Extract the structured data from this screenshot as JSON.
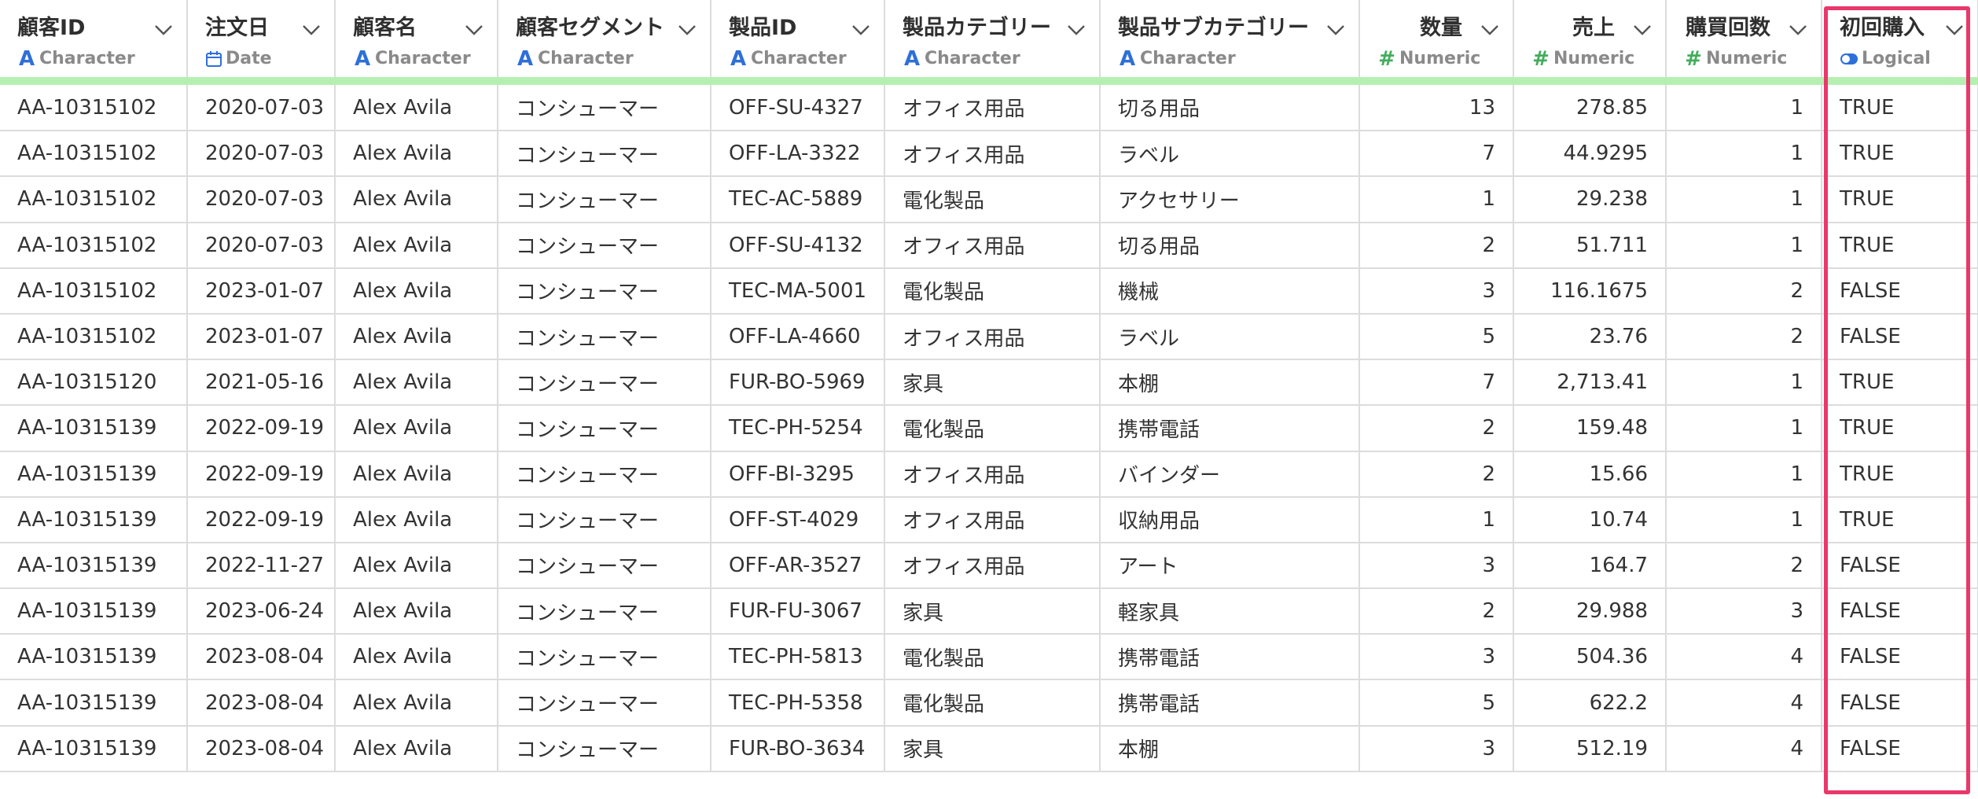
{
  "columns": [
    {
      "name": "顧客ID",
      "type": "Character",
      "type_icon": "character-icon",
      "align": "left"
    },
    {
      "name": "注文日",
      "type": "Date",
      "type_icon": "calendar-icon",
      "align": "left"
    },
    {
      "name": "顧客名",
      "type": "Character",
      "type_icon": "character-icon",
      "align": "left"
    },
    {
      "name": "顧客セグメント",
      "type": "Character",
      "type_icon": "character-icon",
      "align": "left"
    },
    {
      "name": "製品ID",
      "type": "Character",
      "type_icon": "character-icon",
      "align": "left"
    },
    {
      "name": "製品カテゴリー",
      "type": "Character",
      "type_icon": "character-icon",
      "align": "left"
    },
    {
      "name": "製品サブカテゴリー",
      "type": "Character",
      "type_icon": "character-icon",
      "align": "left"
    },
    {
      "name": "数量",
      "type": "Numeric",
      "type_icon": "numeric-icon",
      "align": "right"
    },
    {
      "name": "売上",
      "type": "Numeric",
      "type_icon": "numeric-icon",
      "align": "right"
    },
    {
      "name": "購買回数",
      "type": "Numeric",
      "type_icon": "numeric-icon",
      "align": "right"
    },
    {
      "name": "初回購入",
      "type": "Logical",
      "type_icon": "toggle-icon",
      "align": "left"
    }
  ],
  "rows": [
    [
      "AA-10315102",
      "2020-07-03",
      "Alex Avila",
      "コンシューマー",
      "OFF-SU-4327",
      "オフィス用品",
      "切る用品",
      "13",
      "278.85",
      "1",
      "TRUE"
    ],
    [
      "AA-10315102",
      "2020-07-03",
      "Alex Avila",
      "コンシューマー",
      "OFF-LA-3322",
      "オフィス用品",
      "ラベル",
      "7",
      "44.9295",
      "1",
      "TRUE"
    ],
    [
      "AA-10315102",
      "2020-07-03",
      "Alex Avila",
      "コンシューマー",
      "TEC-AC-5889",
      "電化製品",
      "アクセサリー",
      "1",
      "29.238",
      "1",
      "TRUE"
    ],
    [
      "AA-10315102",
      "2020-07-03",
      "Alex Avila",
      "コンシューマー",
      "OFF-SU-4132",
      "オフィス用品",
      "切る用品",
      "2",
      "51.711",
      "1",
      "TRUE"
    ],
    [
      "AA-10315102",
      "2023-01-07",
      "Alex Avila",
      "コンシューマー",
      "TEC-MA-5001",
      "電化製品",
      "機械",
      "3",
      "116.1675",
      "2",
      "FALSE"
    ],
    [
      "AA-10315102",
      "2023-01-07",
      "Alex Avila",
      "コンシューマー",
      "OFF-LA-4660",
      "オフィス用品",
      "ラベル",
      "5",
      "23.76",
      "2",
      "FALSE"
    ],
    [
      "AA-10315120",
      "2021-05-16",
      "Alex Avila",
      "コンシューマー",
      "FUR-BO-5969",
      "家具",
      "本棚",
      "7",
      "2,713.41",
      "1",
      "TRUE"
    ],
    [
      "AA-10315139",
      "2022-09-19",
      "Alex Avila",
      "コンシューマー",
      "TEC-PH-5254",
      "電化製品",
      "携帯電話",
      "2",
      "159.48",
      "1",
      "TRUE"
    ],
    [
      "AA-10315139",
      "2022-09-19",
      "Alex Avila",
      "コンシューマー",
      "OFF-BI-3295",
      "オフィス用品",
      "バインダー",
      "2",
      "15.66",
      "1",
      "TRUE"
    ],
    [
      "AA-10315139",
      "2022-09-19",
      "Alex Avila",
      "コンシューマー",
      "OFF-ST-4029",
      "オフィス用品",
      "収納用品",
      "1",
      "10.74",
      "1",
      "TRUE"
    ],
    [
      "AA-10315139",
      "2022-11-27",
      "Alex Avila",
      "コンシューマー",
      "OFF-AR-3527",
      "オフィス用品",
      "アート",
      "3",
      "164.7",
      "2",
      "FALSE"
    ],
    [
      "AA-10315139",
      "2023-06-24",
      "Alex Avila",
      "コンシューマー",
      "FUR-FU-3067",
      "家具",
      "軽家具",
      "2",
      "29.988",
      "3",
      "FALSE"
    ],
    [
      "AA-10315139",
      "2023-08-04",
      "Alex Avila",
      "コンシューマー",
      "TEC-PH-5813",
      "電化製品",
      "携帯電話",
      "3",
      "504.36",
      "4",
      "FALSE"
    ],
    [
      "AA-10315139",
      "2023-08-04",
      "Alex Avila",
      "コンシューマー",
      "TEC-PH-5358",
      "電化製品",
      "携帯電話",
      "5",
      "622.2",
      "4",
      "FALSE"
    ],
    [
      "AA-10315139",
      "2023-08-04",
      "Alex Avila",
      "コンシューマー",
      "FUR-BO-3634",
      "家具",
      "本棚",
      "3",
      "512.19",
      "4",
      "FALSE"
    ]
  ],
  "colors": {
    "highlight_border": "#e8386c",
    "quality_bar": "#b6efb2",
    "character_icon": "#2e6fd9",
    "numeric_icon": "#43ad5b"
  }
}
